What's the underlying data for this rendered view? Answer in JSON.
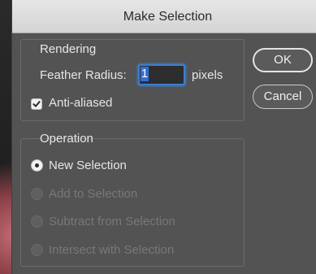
{
  "dialog": {
    "title": "Make Selection"
  },
  "rendering": {
    "group_label": "Rendering",
    "feather_label": "Feather Radius:",
    "feather_value": "1",
    "feather_unit": "pixels",
    "anti_aliased_label": "Anti-aliased",
    "anti_aliased_checked": true
  },
  "operation": {
    "group_label": "Operation",
    "options": [
      {
        "label": "New Selection",
        "selected": true,
        "enabled": true
      },
      {
        "label": "Add to Selection",
        "selected": false,
        "enabled": false
      },
      {
        "label": "Subtract from Selection",
        "selected": false,
        "enabled": false
      },
      {
        "label": "Intersect with Selection",
        "selected": false,
        "enabled": false
      }
    ]
  },
  "buttons": {
    "ok_label": "OK",
    "cancel_label": "Cancel"
  },
  "colors": {
    "dialog_bg": "#535353",
    "accent": "#3f7fcf"
  }
}
